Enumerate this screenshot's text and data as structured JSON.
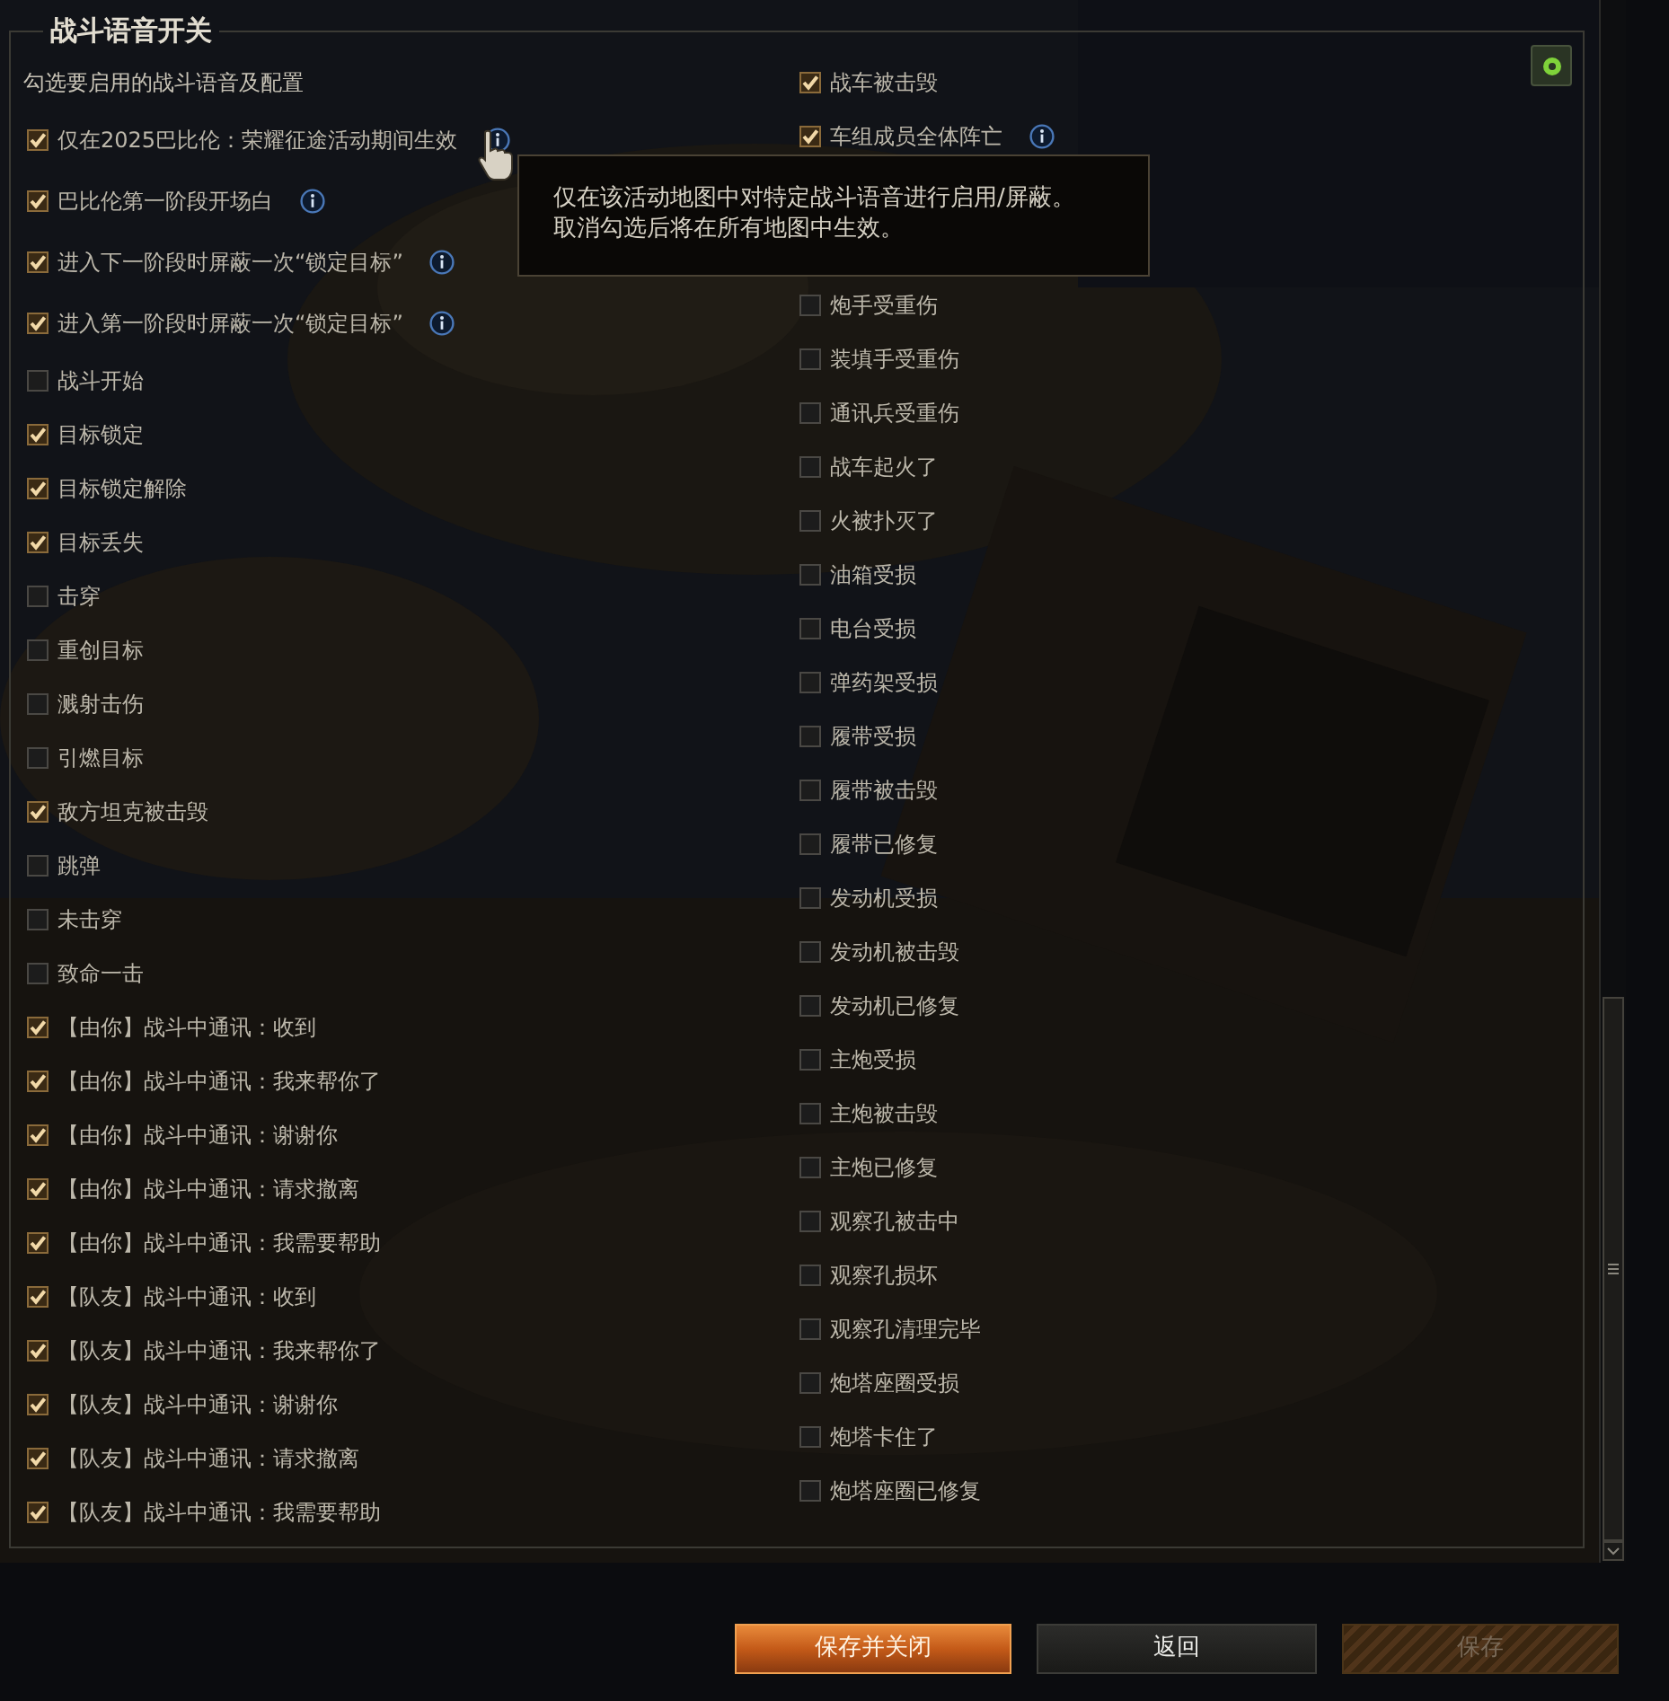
{
  "panel": {
    "title": "战斗语音开关",
    "subtitle": "勾选要启用的战斗语音及配置"
  },
  "left_options": [
    {
      "label": "仅在2025巴比伦：荣耀征途活动期间生效",
      "checked": true,
      "kind": "info"
    },
    {
      "label": "巴比伦第一阶段开场白",
      "checked": true,
      "kind": "info"
    },
    {
      "label": "进入下一阶段时屏蔽一次“锁定目标”",
      "checked": true,
      "kind": "info"
    },
    {
      "label": "进入第一阶段时屏蔽一次“锁定目标”",
      "checked": true,
      "kind": "info"
    },
    {
      "label": "战斗开始",
      "checked": false,
      "kind": "plain"
    },
    {
      "label": "目标锁定",
      "checked": true,
      "kind": "plain"
    },
    {
      "label": "目标锁定解除",
      "checked": true,
      "kind": "plain"
    },
    {
      "label": "目标丢失",
      "checked": true,
      "kind": "plain"
    },
    {
      "label": "击穿",
      "checked": false,
      "kind": "plain"
    },
    {
      "label": "重创目标",
      "checked": false,
      "kind": "plain"
    },
    {
      "label": "溅射击伤",
      "checked": false,
      "kind": "plain"
    },
    {
      "label": "引燃目标",
      "checked": false,
      "kind": "plain"
    },
    {
      "label": "敌方坦克被击毁",
      "checked": true,
      "kind": "plain"
    },
    {
      "label": "跳弹",
      "checked": false,
      "kind": "plain"
    },
    {
      "label": "未击穿",
      "checked": false,
      "kind": "plain"
    },
    {
      "label": "致命一击",
      "checked": false,
      "kind": "plain"
    },
    {
      "label": "【由你】战斗中通讯：收到",
      "checked": true,
      "kind": "plain"
    },
    {
      "label": "【由你】战斗中通讯：我来帮你了",
      "checked": true,
      "kind": "plain"
    },
    {
      "label": "【由你】战斗中通讯：谢谢你",
      "checked": true,
      "kind": "plain"
    },
    {
      "label": "【由你】战斗中通讯：请求撤离",
      "checked": true,
      "kind": "plain"
    },
    {
      "label": "【由你】战斗中通讯：我需要帮助",
      "checked": true,
      "kind": "plain"
    },
    {
      "label": "【队友】战斗中通讯：收到",
      "checked": true,
      "kind": "plain"
    },
    {
      "label": "【队友】战斗中通讯：我来帮你了",
      "checked": true,
      "kind": "plain"
    },
    {
      "label": "【队友】战斗中通讯：谢谢你",
      "checked": true,
      "kind": "plain"
    },
    {
      "label": "【队友】战斗中通讯：请求撤离",
      "checked": true,
      "kind": "plain"
    },
    {
      "label": "【队友】战斗中通讯：我需要帮助",
      "checked": true,
      "kind": "plain"
    }
  ],
  "right_options_above_tooltip": [
    {
      "label": "战车被击毁",
      "checked": true,
      "kind": "plain"
    },
    {
      "label": "车组成员全体阵亡",
      "checked": true,
      "kind": "info"
    }
  ],
  "right_options_below_tooltip": [
    {
      "label": "炮手受重伤",
      "checked": false,
      "kind": "plain"
    },
    {
      "label": "装填手受重伤",
      "checked": false,
      "kind": "plain"
    },
    {
      "label": "通讯兵受重伤",
      "checked": false,
      "kind": "plain"
    },
    {
      "label": "战车起火了",
      "checked": false,
      "kind": "plain"
    },
    {
      "label": "火被扑灭了",
      "checked": false,
      "kind": "plain"
    },
    {
      "label": "油箱受损",
      "checked": false,
      "kind": "plain"
    },
    {
      "label": "电台受损",
      "checked": false,
      "kind": "plain"
    },
    {
      "label": "弹药架受损",
      "checked": false,
      "kind": "plain"
    },
    {
      "label": "履带受损",
      "checked": false,
      "kind": "plain"
    },
    {
      "label": "履带被击毁",
      "checked": false,
      "kind": "plain"
    },
    {
      "label": "履带已修复",
      "checked": false,
      "kind": "plain"
    },
    {
      "label": "发动机受损",
      "checked": false,
      "kind": "plain"
    },
    {
      "label": "发动机被击毁",
      "checked": false,
      "kind": "plain"
    },
    {
      "label": "发动机已修复",
      "checked": false,
      "kind": "plain"
    },
    {
      "label": "主炮受损",
      "checked": false,
      "kind": "plain"
    },
    {
      "label": "主炮被击毁",
      "checked": false,
      "kind": "plain"
    },
    {
      "label": "主炮已修复",
      "checked": false,
      "kind": "plain"
    },
    {
      "label": "观察孔被击中",
      "checked": false,
      "kind": "plain"
    },
    {
      "label": "观察孔损坏",
      "checked": false,
      "kind": "plain"
    },
    {
      "label": "观察孔清理完毕",
      "checked": false,
      "kind": "plain"
    },
    {
      "label": "炮塔座圈受损",
      "checked": false,
      "kind": "plain"
    },
    {
      "label": "炮塔卡住了",
      "checked": false,
      "kind": "plain"
    },
    {
      "label": "炮塔座圈已修复",
      "checked": false,
      "kind": "plain"
    }
  ],
  "tooltip": {
    "lines": [
      "仅在该活动地图中对特定战斗语音进行启用/屏蔽。",
      "取消勾选后将在所有地图中生效。"
    ]
  },
  "buttons": [
    {
      "label": "保存并关闭",
      "kind": "primary",
      "disabled": false
    },
    {
      "label": "返回",
      "kind": "secondary",
      "disabled": false
    },
    {
      "label": "保存",
      "kind": "primary",
      "disabled": true
    }
  ]
}
